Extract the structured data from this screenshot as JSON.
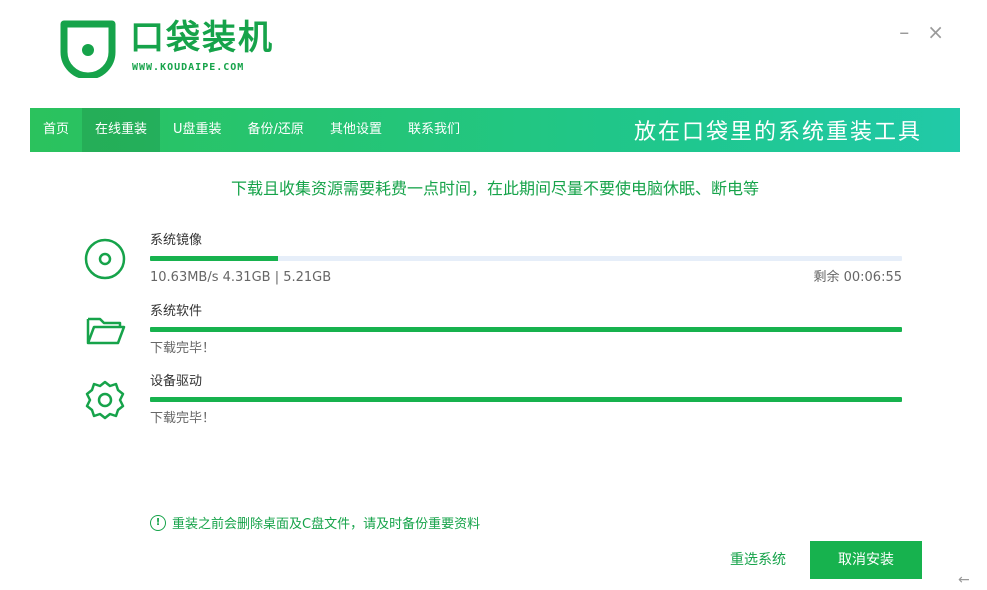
{
  "app": {
    "name": "口袋装机",
    "url": "WWW.KOUDAIPE.COM",
    "minimize_symbol": "–",
    "close_symbol": "×",
    "brand_color": "#16a34a"
  },
  "nav": {
    "items": [
      {
        "label": "首页"
      },
      {
        "label": "在线重装"
      },
      {
        "label": "U盘重装"
      },
      {
        "label": "备份/还原"
      },
      {
        "label": "其他设置"
      },
      {
        "label": "联系我们"
      }
    ],
    "active_index": 1,
    "slogan": "放在口袋里的系统重装工具"
  },
  "notice": "下载且收集资源需要耗费一点时间，在此期间尽量不要使电脑休眠、断电等",
  "downloads": [
    {
      "icon": "disc-icon",
      "name": "系统镜像",
      "progress": 0.17,
      "status": "10.63MB/s 4.31GB | 5.21GB",
      "remaining": "剩余 00:06:55"
    },
    {
      "icon": "folder-icon",
      "name": "系统软件",
      "progress": 1.0,
      "status": "下载完毕！",
      "remaining": ""
    },
    {
      "icon": "gear-icon",
      "name": "设备驱动",
      "progress": 1.0,
      "status": "下载完毕！",
      "remaining": ""
    }
  ],
  "warning": {
    "icon_symbol": "!",
    "text": "重装之前会删除桌面及C盘文件，请及时备份重要资料"
  },
  "buttons": {
    "reselect": "重选系统",
    "cancel": "取消安装"
  },
  "corner_arrow": "←"
}
